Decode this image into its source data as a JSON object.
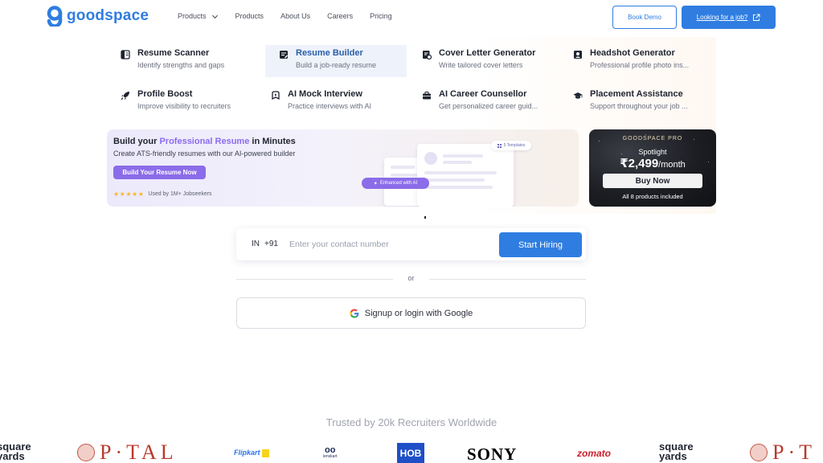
{
  "brand": {
    "name": "goodspace",
    "color": "#2f7de1"
  },
  "nav": {
    "items": [
      {
        "label": "Products",
        "dropdown": true
      },
      {
        "label": "Products"
      },
      {
        "label": "About Us"
      },
      {
        "label": "Careers"
      },
      {
        "label": "Pricing"
      }
    ]
  },
  "header": {
    "demo_label": "Book Demo",
    "job_label": "Looking for a job?"
  },
  "menu": {
    "items": [
      {
        "title": "Resume Scanner",
        "sub": "Identify strengths and gaps",
        "icon": "resume-scanner-icon"
      },
      {
        "title": "Resume Builder",
        "sub": "Build a job-ready resume",
        "icon": "resume-builder-icon",
        "active": true
      },
      {
        "title": "Cover Letter Generator",
        "sub": "Write tailored cover letters",
        "icon": "cover-letter-icon"
      },
      {
        "title": "Headshot Generator",
        "sub": "Professional profile photo ins...",
        "icon": "headshot-icon"
      },
      {
        "title": "Profile Boost",
        "sub": "Improve visibility to recruiters",
        "icon": "rocket-icon"
      },
      {
        "title": "AI Mock Interview",
        "sub": "Practice interviews with AI",
        "icon": "interview-icon"
      },
      {
        "title": "AI Career Counsellor",
        "sub": "Get personalized career guid...",
        "icon": "briefcase-icon"
      },
      {
        "title": "Placement Assistance",
        "sub": "Support throughout your job ...",
        "icon": "graduation-cap-icon"
      }
    ]
  },
  "promo": {
    "title_pre": "Build your ",
    "title_hl": "Professional Resume",
    "title_post": " in Minutes",
    "sub": "Create ATS-friendly resumes with our AI-powered builder",
    "button": "Build Your Resume Now",
    "stars": "★★★★★",
    "rating_text": "Used by 1M+ Jobseekers",
    "chip_templates": "5 Templates",
    "chip_ai": "Enhanced with AI"
  },
  "pro": {
    "label": "GOODSPACE PRO",
    "sub": "Spotlight",
    "price": "₹2,499",
    "per": "/month",
    "button": "Buy Now",
    "note": "All 8 products included"
  },
  "login": {
    "country_code": "IN",
    "dial_code": "+91",
    "phone_placeholder": "Enter your contact number",
    "phone_value": "",
    "hire_button": "Start Hiring",
    "or_text": "or",
    "google_button": "Signup or login with Google"
  },
  "trusted": {
    "title": "Trusted by 20k Recruiters Worldwide",
    "logos": [
      "square yards",
      "P·TAL",
      "Flipkart",
      "lenskart",
      "HOB",
      "SONY",
      "zomato",
      "square yards",
      "P·T"
    ]
  }
}
